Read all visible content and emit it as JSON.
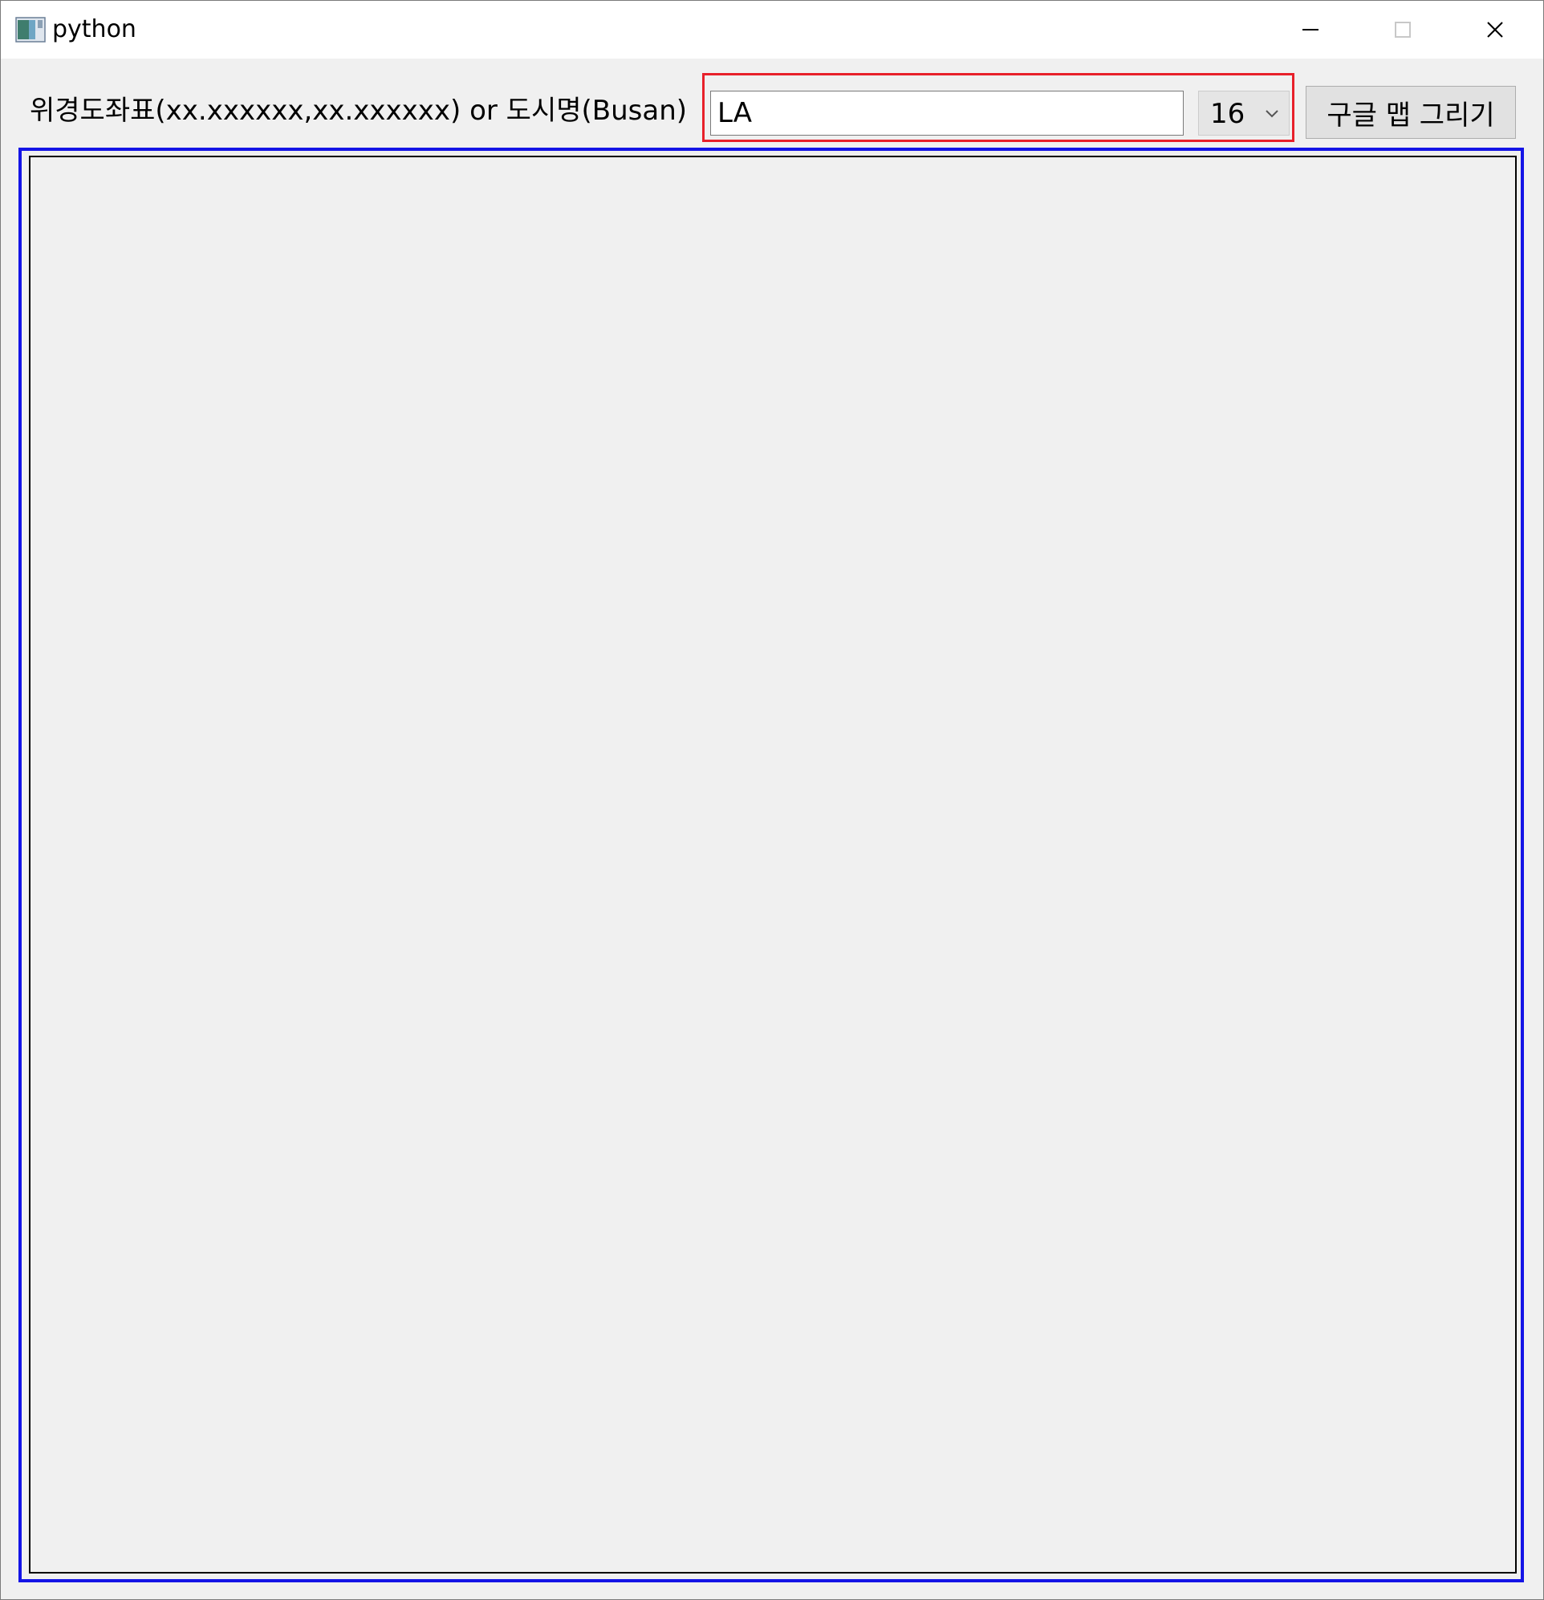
{
  "window": {
    "title": "python",
    "icon": "python-app-icon",
    "controls": {
      "minimize": "minimize-icon",
      "maximize": "maximize-icon",
      "close": "close-icon"
    }
  },
  "toolbar": {
    "label": "위경도좌표(xx.xxxxxx,xx.xxxxxx) or 도시명(Busan)",
    "location_input": {
      "value": "LA",
      "placeholder": ""
    },
    "zoom_select": {
      "selected": "16"
    },
    "draw_button_label": "구글 맵 그리기"
  },
  "colors": {
    "highlight_input": "#e8202a",
    "highlight_map": "#1414e6"
  }
}
